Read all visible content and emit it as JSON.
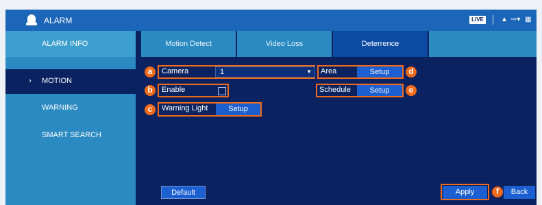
{
  "window": {
    "title": "ALARM"
  },
  "titlebar": {
    "live_badge": "LIVE"
  },
  "sidebar": {
    "header": "ALARM INFO",
    "items": [
      {
        "label": "MOTION",
        "active": true
      },
      {
        "label": "WARNING",
        "active": false
      },
      {
        "label": "SMART SEARCH",
        "active": false
      }
    ]
  },
  "tabs": [
    {
      "label": "Motion Detect",
      "active": false
    },
    {
      "label": "Video Loss",
      "active": false
    },
    {
      "label": "Deterrence",
      "active": true
    }
  ],
  "form": {
    "camera_label": "Camera",
    "camera_value": "1",
    "enable_label": "Enable",
    "enable_checked": false,
    "warning_light_label": "Warning Light",
    "warning_light_button": "Setup",
    "area_label": "Area",
    "area_button": "Setup",
    "schedule_label": "Schedule",
    "schedule_button": "Setup"
  },
  "footer": {
    "default_button": "Default",
    "apply_button": "Apply",
    "back_button": "Back"
  },
  "markers": {
    "a": "a",
    "b": "b",
    "c": "c",
    "d": "d",
    "e": "e",
    "f": "f"
  },
  "colors": {
    "titlebar": "#1b66b8",
    "panel": "#0a2360",
    "sidebar": "#2b8ac1",
    "tab_active": "#0c4ba4",
    "button": "#1b5fd0",
    "highlight": "#f26a1b"
  }
}
